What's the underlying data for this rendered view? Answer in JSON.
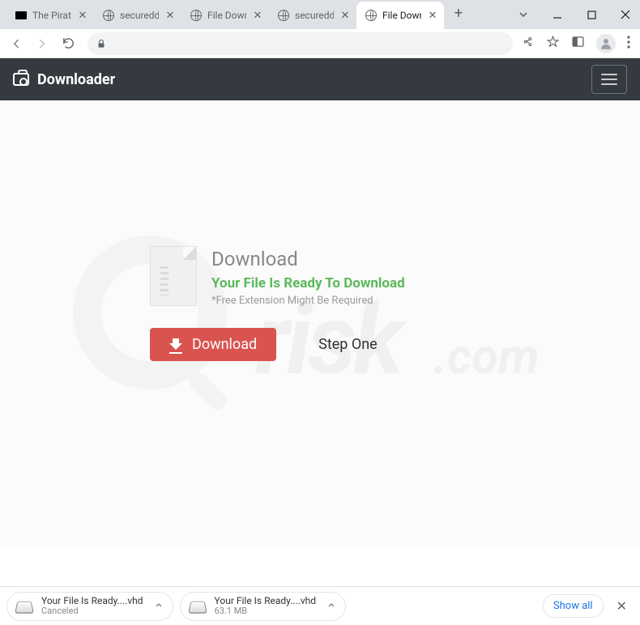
{
  "tabs": [
    {
      "title": "The Pirate",
      "icon": "pirate"
    },
    {
      "title": "secureddo...",
      "icon": "globe"
    },
    {
      "title": "File Downlo",
      "icon": "globe"
    },
    {
      "title": "secureddo...",
      "icon": "globe"
    },
    {
      "title": "File Downlo",
      "icon": "globe",
      "active": true
    }
  ],
  "page": {
    "brand": "Downloader",
    "heading": "Download",
    "ready": "Your File Is Ready To Download",
    "note": "*Free Extension Might Be Required",
    "download_btn": "Download",
    "step_btn": "Step One"
  },
  "downloads": [
    {
      "name": "Your File Is Ready....vhd",
      "status": "Canceled"
    },
    {
      "name": "Your File Is Ready....vhd",
      "status": "63.1 MB"
    }
  ],
  "showall": "Show all",
  "watermark": "pcrisk.com"
}
